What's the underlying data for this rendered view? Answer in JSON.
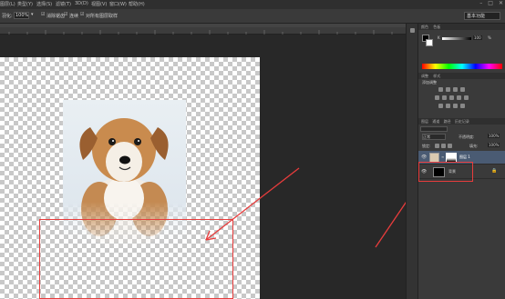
{
  "menubar": {
    "items": [
      "图层(L)",
      "类型(Y)",
      "选择(S)",
      "滤镜(T)",
      "3D(D)",
      "视图(V)",
      "窗口(W)",
      "帮助(H)"
    ]
  },
  "options": {
    "feather_label": "羽化:",
    "feather_value": "100%",
    "antialias_label": "消除锯齿",
    "contiguous_label": "连续",
    "all_layers_label": "对所有图层取样",
    "workspace_label": "基本功能"
  },
  "color_panel": {
    "tab_color": "颜色",
    "tab_swatches": "色板",
    "k_label": "K",
    "k_value": "100",
    "unit": "%"
  },
  "adjust_panel": {
    "tab_adjust": "调整",
    "tab_styles": "样式",
    "add_label": "添加调整"
  },
  "layers_panel": {
    "tabs": [
      "图层",
      "通道",
      "路径",
      "历史记录"
    ],
    "blend_mode": "正常",
    "opacity_label": "不透明度:",
    "opacity_value": "100%",
    "lock_label": "锁定:",
    "fill_label": "填充:",
    "fill_value": "100%",
    "layers": [
      {
        "name": "图层 1",
        "selected": true
      },
      {
        "name": "背景",
        "selected": false
      }
    ]
  },
  "colors": {
    "annotation_red": "#e83c3c",
    "selected_layer": "#4a5b73"
  }
}
